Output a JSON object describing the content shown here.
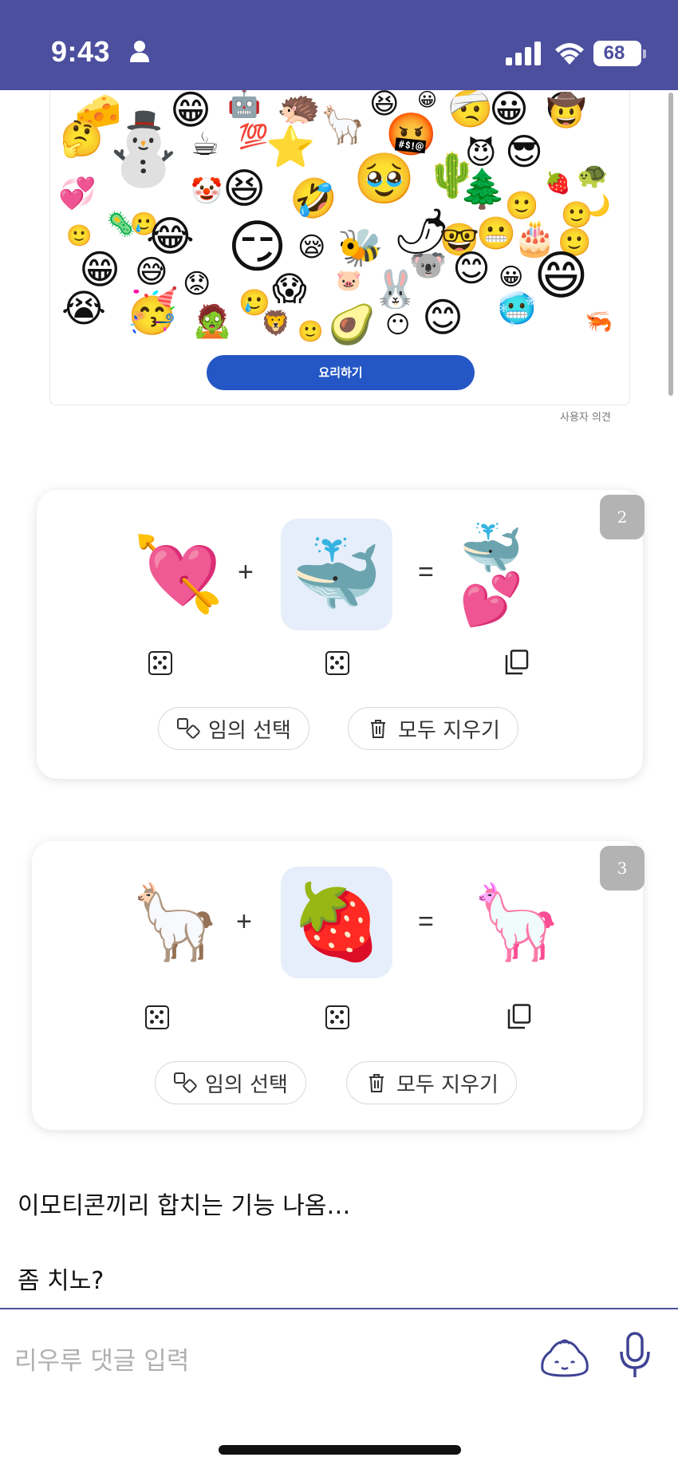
{
  "status": {
    "time": "9:43",
    "battery": "68"
  },
  "image": {
    "cook_button": "요리하기",
    "feedback": "사용자 의견"
  },
  "combos": [
    {
      "number": "2",
      "left_emoji": "💘",
      "right_emoji": "🐳",
      "result_emoji": "🐳💕",
      "random_label": "임의 선택",
      "clear_label": "모두 지우기"
    },
    {
      "number": "3",
      "left_emoji": "🦙",
      "right_emoji": "🍓",
      "result_emoji": "🦙",
      "random_label": "임의 선택",
      "clear_label": "모두 지우기"
    }
  ],
  "post": {
    "line1": "이모티콘끼리 합치는 기능 나옴…",
    "line2": "좀 치노?"
  },
  "comment": {
    "placeholder": "리우루 댓글 입력"
  },
  "colors": {
    "statusbar": "#4c4f9e",
    "button": "#2457c5",
    "selected_slot": "#e6eefb"
  },
  "icons": [
    "person-icon",
    "signal-icon",
    "wifi-icon",
    "dice-icon",
    "copy-icon",
    "shuffle-icon",
    "trash-icon",
    "dumpling-icon",
    "mic-icon"
  ]
}
